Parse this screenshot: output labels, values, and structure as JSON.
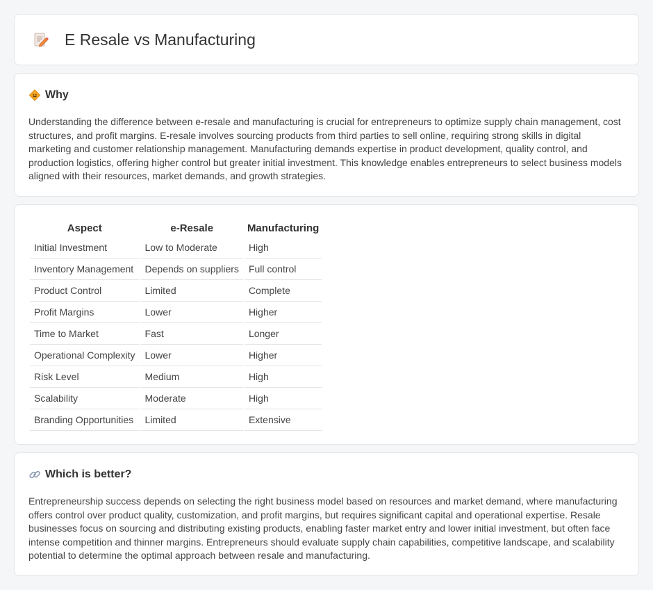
{
  "header": {
    "title": "E Resale vs Manufacturing",
    "icon": "memo-pencil-icon"
  },
  "why": {
    "heading": "Why",
    "icon": "diamond-sign-icon",
    "text": "Understanding the difference between e-resale and manufacturing is crucial for entrepreneurs to optimize supply chain management, cost structures, and profit margins. E-resale involves sourcing products from third parties to sell online, requiring strong skills in digital marketing and customer relationship management. Manufacturing demands expertise in product development, quality control, and production logistics, offering higher control but greater initial investment. This knowledge enables entrepreneurs to select business models aligned with their resources, market demands, and growth strategies."
  },
  "comparison": {
    "headers": [
      "Aspect",
      "e-Resale",
      "Manufacturing"
    ],
    "rows": [
      [
        "Initial Investment",
        "Low to Moderate",
        "High"
      ],
      [
        "Inventory Management",
        "Depends on suppliers",
        "Full control"
      ],
      [
        "Product Control",
        "Limited",
        "Complete"
      ],
      [
        "Profit Margins",
        "Lower",
        "Higher"
      ],
      [
        "Time to Market",
        "Fast",
        "Longer"
      ],
      [
        "Operational Complexity",
        "Lower",
        "Higher"
      ],
      [
        "Risk Level",
        "Medium",
        "High"
      ],
      [
        "Scalability",
        "Moderate",
        "High"
      ],
      [
        "Branding Opportunities",
        "Limited",
        "Extensive"
      ]
    ]
  },
  "better": {
    "heading": "Which is better?",
    "icon": "link-icon",
    "text": "Entrepreneurship success depends on selecting the right business model based on resources and market demand, where manufacturing offers control over product quality, customization, and profit margins, but requires significant capital and operational expertise. Resale businesses focus on sourcing and distributing existing products, enabling faster market entry and lower initial investment, but often face intense competition and thinner margins. Entrepreneurs should evaluate supply chain capabilities, competitive landscape, and scalability potential to determine the optimal approach between resale and manufacturing."
  },
  "colors": {
    "accent_orange": "#f5a623",
    "background": "#f5f6f8"
  }
}
